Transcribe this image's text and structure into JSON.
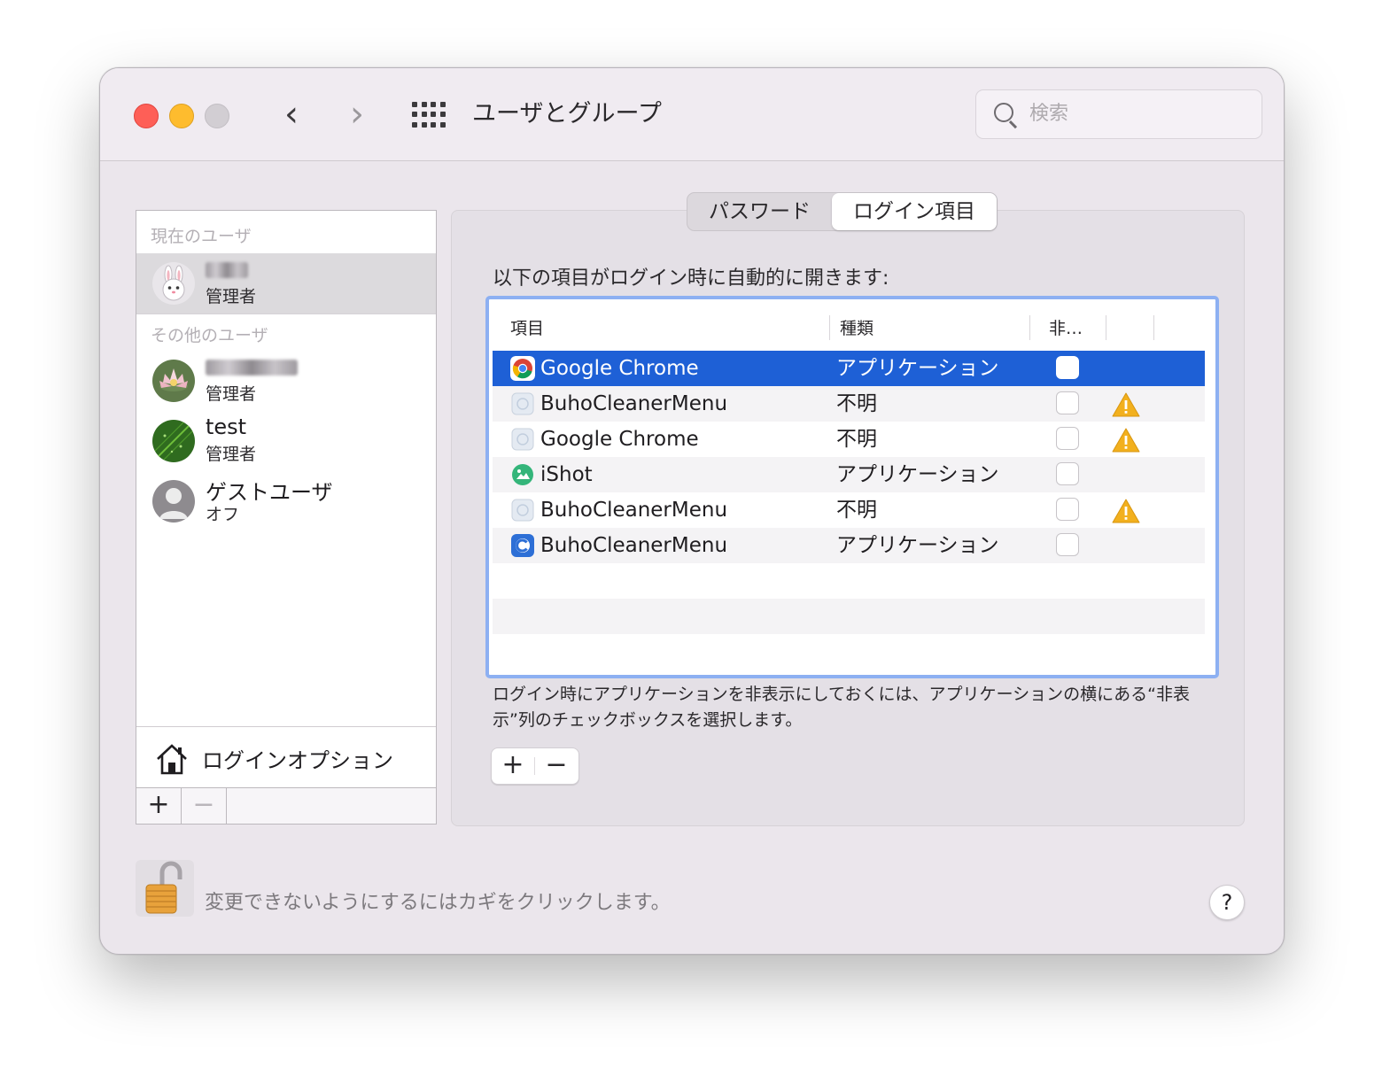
{
  "window": {
    "title": "ユーザとグループ",
    "search_placeholder": "検索"
  },
  "tabs": [
    {
      "label": "パスワード",
      "active": false
    },
    {
      "label": "ログイン項目",
      "active": true
    }
  ],
  "sidebar": {
    "current_users_label": "現在のユーザ",
    "other_users_label": "その他のユーザ",
    "current_user": {
      "name": "",
      "role": "管理者",
      "avatar": "rabbit-icon"
    },
    "others": [
      {
        "name": "",
        "role": "管理者",
        "avatar": "lotus-flower-image"
      },
      {
        "name": "test",
        "role": "管理者",
        "avatar": "green-leaf-image"
      },
      {
        "name": "ゲストユーザ",
        "role": "オフ",
        "avatar": "guest-silhouette-icon"
      }
    ],
    "login_options_label": "ログインオプション",
    "add_label": "+",
    "remove_label": "−"
  },
  "main": {
    "heading": "以下の項目がログイン時に自動的に開きます:",
    "columns": [
      "項目",
      "種類",
      "非…"
    ],
    "rows": [
      {
        "name": "Google Chrome",
        "kind": "アプリケーション",
        "icon": "chrome-icon",
        "hidden": false,
        "warning": false,
        "selected": true
      },
      {
        "name": "BuhoCleanerMenu",
        "kind": "不明",
        "icon": "generic-app-icon",
        "hidden": false,
        "warning": true,
        "selected": false
      },
      {
        "name": "Google Chrome",
        "kind": "不明",
        "icon": "generic-app-icon",
        "hidden": false,
        "warning": true,
        "selected": false
      },
      {
        "name": "iShot",
        "kind": "アプリケーション",
        "icon": "ishot-icon",
        "hidden": false,
        "warning": false,
        "selected": false
      },
      {
        "name": "BuhoCleanerMenu",
        "kind": "不明",
        "icon": "generic-app-icon",
        "hidden": false,
        "warning": true,
        "selected": false
      },
      {
        "name": "BuhoCleanerMenu",
        "kind": "アプリケーション",
        "icon": "buhocleaner-icon",
        "hidden": false,
        "warning": false,
        "selected": false
      }
    ],
    "note": "ログイン時にアプリケーションを非表示にしておくには、アプリケーションの横にある“非表示”列のチェックボックスを選択します。",
    "add_label": "+",
    "remove_label": "−"
  },
  "footer": {
    "lock_text": "変更できないようにするにはカギをクリックします。",
    "help_label": "?"
  },
  "colors": {
    "selection": "#1e60d6",
    "focus_ring": "#8db0f2",
    "close": "#fe5f57",
    "minimize": "#febc2e",
    "warning": "#f2b01e"
  }
}
